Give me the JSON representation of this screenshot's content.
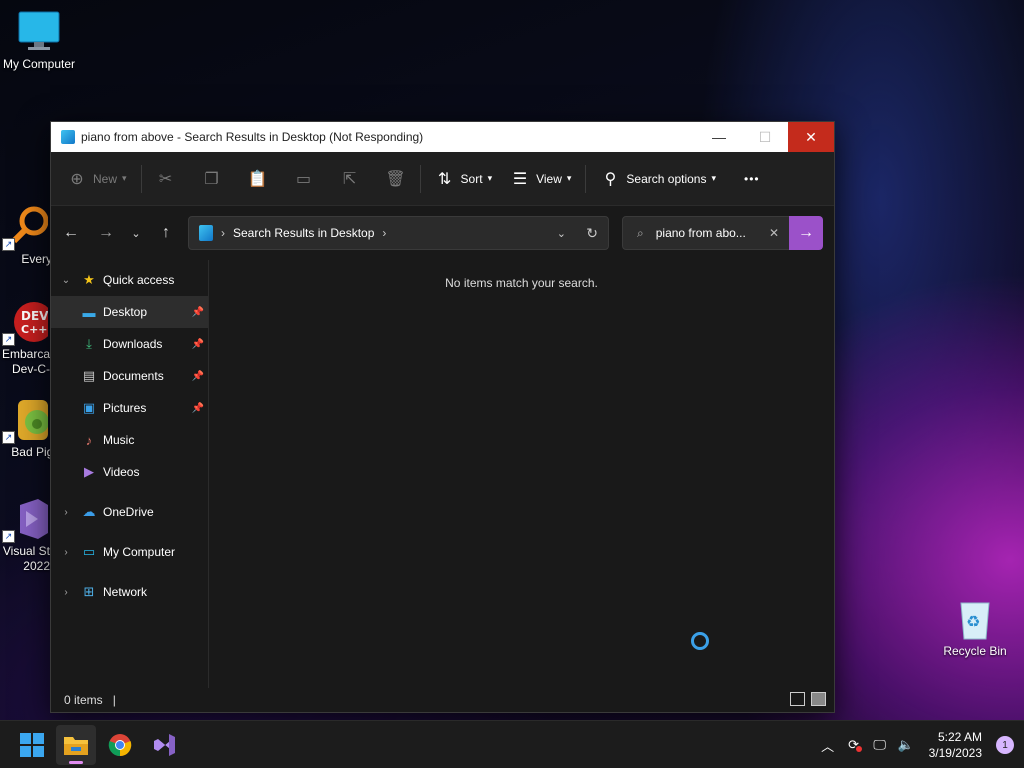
{
  "desktop": {
    "icons": [
      {
        "label": "My Computer"
      },
      {
        "label": "Everyth"
      },
      {
        "label": "Embarca Dev-C-"
      },
      {
        "label": "Bad Pigg"
      },
      {
        "label": "Visual St 2022"
      },
      {
        "label": "Recycle Bin"
      }
    ]
  },
  "window": {
    "title": "piano from above - Search Results in Desktop (Not Responding)",
    "controls": {
      "minimize": "—",
      "maximize": "☐",
      "close": "✕"
    },
    "toolbar": {
      "new_label": "New",
      "sort_label": "Sort",
      "view_label": "View",
      "search_options_label": "Search options",
      "more_label": "•••"
    },
    "address": {
      "path": "Search Results in Desktop",
      "search_value": "piano from abo..."
    },
    "nav": {
      "quick_access": "Quick access",
      "items": [
        {
          "label": "Desktop",
          "icon": "desktop-folder-icon",
          "pinned": true,
          "selected": true
        },
        {
          "label": "Downloads",
          "icon": "download-icon",
          "pinned": true
        },
        {
          "label": "Documents",
          "icon": "document-icon",
          "pinned": true
        },
        {
          "label": "Pictures",
          "icon": "picture-icon",
          "pinned": true
        },
        {
          "label": "Music",
          "icon": "music-icon",
          "pinned": false
        },
        {
          "label": "Videos",
          "icon": "video-icon",
          "pinned": false
        }
      ],
      "roots": [
        {
          "label": "OneDrive",
          "icon": "cloud-icon"
        },
        {
          "label": "My Computer",
          "icon": "computer-icon"
        },
        {
          "label": "Network",
          "icon": "network-icon"
        }
      ]
    },
    "main": {
      "empty_message": "No items match your search."
    },
    "status": {
      "items_count": "0 items",
      "cursor": "|"
    }
  },
  "taskbar": {
    "apps": [
      "start",
      "file-explorer",
      "chrome",
      "visual-studio"
    ],
    "clock_time": "5:22 AM",
    "clock_date": "3/19/2023",
    "notification_count": "1"
  },
  "colors": {
    "accent": "#9b51c9",
    "close": "#c42b1c",
    "spinner": "#3ba0e8"
  }
}
